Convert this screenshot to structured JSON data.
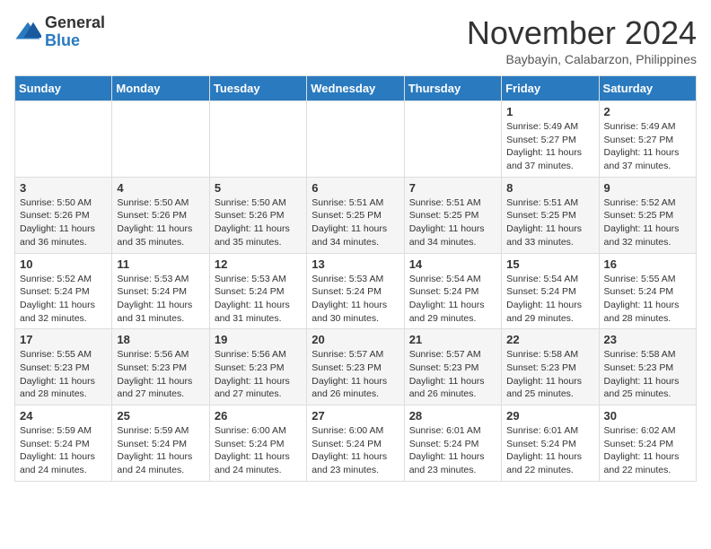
{
  "logo": {
    "general": "General",
    "blue": "Blue"
  },
  "title": "November 2024",
  "location": "Baybayin, Calabarzon, Philippines",
  "weekdays": [
    "Sunday",
    "Monday",
    "Tuesday",
    "Wednesday",
    "Thursday",
    "Friday",
    "Saturday"
  ],
  "weeks": [
    [
      {
        "day": "",
        "info": ""
      },
      {
        "day": "",
        "info": ""
      },
      {
        "day": "",
        "info": ""
      },
      {
        "day": "",
        "info": ""
      },
      {
        "day": "",
        "info": ""
      },
      {
        "day": "1",
        "info": "Sunrise: 5:49 AM\nSunset: 5:27 PM\nDaylight: 11 hours and 37 minutes."
      },
      {
        "day": "2",
        "info": "Sunrise: 5:49 AM\nSunset: 5:27 PM\nDaylight: 11 hours and 37 minutes."
      }
    ],
    [
      {
        "day": "3",
        "info": "Sunrise: 5:50 AM\nSunset: 5:26 PM\nDaylight: 11 hours and 36 minutes."
      },
      {
        "day": "4",
        "info": "Sunrise: 5:50 AM\nSunset: 5:26 PM\nDaylight: 11 hours and 35 minutes."
      },
      {
        "day": "5",
        "info": "Sunrise: 5:50 AM\nSunset: 5:26 PM\nDaylight: 11 hours and 35 minutes."
      },
      {
        "day": "6",
        "info": "Sunrise: 5:51 AM\nSunset: 5:25 PM\nDaylight: 11 hours and 34 minutes."
      },
      {
        "day": "7",
        "info": "Sunrise: 5:51 AM\nSunset: 5:25 PM\nDaylight: 11 hours and 34 minutes."
      },
      {
        "day": "8",
        "info": "Sunrise: 5:51 AM\nSunset: 5:25 PM\nDaylight: 11 hours and 33 minutes."
      },
      {
        "day": "9",
        "info": "Sunrise: 5:52 AM\nSunset: 5:25 PM\nDaylight: 11 hours and 32 minutes."
      }
    ],
    [
      {
        "day": "10",
        "info": "Sunrise: 5:52 AM\nSunset: 5:24 PM\nDaylight: 11 hours and 32 minutes."
      },
      {
        "day": "11",
        "info": "Sunrise: 5:53 AM\nSunset: 5:24 PM\nDaylight: 11 hours and 31 minutes."
      },
      {
        "day": "12",
        "info": "Sunrise: 5:53 AM\nSunset: 5:24 PM\nDaylight: 11 hours and 31 minutes."
      },
      {
        "day": "13",
        "info": "Sunrise: 5:53 AM\nSunset: 5:24 PM\nDaylight: 11 hours and 30 minutes."
      },
      {
        "day": "14",
        "info": "Sunrise: 5:54 AM\nSunset: 5:24 PM\nDaylight: 11 hours and 29 minutes."
      },
      {
        "day": "15",
        "info": "Sunrise: 5:54 AM\nSunset: 5:24 PM\nDaylight: 11 hours and 29 minutes."
      },
      {
        "day": "16",
        "info": "Sunrise: 5:55 AM\nSunset: 5:24 PM\nDaylight: 11 hours and 28 minutes."
      }
    ],
    [
      {
        "day": "17",
        "info": "Sunrise: 5:55 AM\nSunset: 5:23 PM\nDaylight: 11 hours and 28 minutes."
      },
      {
        "day": "18",
        "info": "Sunrise: 5:56 AM\nSunset: 5:23 PM\nDaylight: 11 hours and 27 minutes."
      },
      {
        "day": "19",
        "info": "Sunrise: 5:56 AM\nSunset: 5:23 PM\nDaylight: 11 hours and 27 minutes."
      },
      {
        "day": "20",
        "info": "Sunrise: 5:57 AM\nSunset: 5:23 PM\nDaylight: 11 hours and 26 minutes."
      },
      {
        "day": "21",
        "info": "Sunrise: 5:57 AM\nSunset: 5:23 PM\nDaylight: 11 hours and 26 minutes."
      },
      {
        "day": "22",
        "info": "Sunrise: 5:58 AM\nSunset: 5:23 PM\nDaylight: 11 hours and 25 minutes."
      },
      {
        "day": "23",
        "info": "Sunrise: 5:58 AM\nSunset: 5:23 PM\nDaylight: 11 hours and 25 minutes."
      }
    ],
    [
      {
        "day": "24",
        "info": "Sunrise: 5:59 AM\nSunset: 5:24 PM\nDaylight: 11 hours and 24 minutes."
      },
      {
        "day": "25",
        "info": "Sunrise: 5:59 AM\nSunset: 5:24 PM\nDaylight: 11 hours and 24 minutes."
      },
      {
        "day": "26",
        "info": "Sunrise: 6:00 AM\nSunset: 5:24 PM\nDaylight: 11 hours and 24 minutes."
      },
      {
        "day": "27",
        "info": "Sunrise: 6:00 AM\nSunset: 5:24 PM\nDaylight: 11 hours and 23 minutes."
      },
      {
        "day": "28",
        "info": "Sunrise: 6:01 AM\nSunset: 5:24 PM\nDaylight: 11 hours and 23 minutes."
      },
      {
        "day": "29",
        "info": "Sunrise: 6:01 AM\nSunset: 5:24 PM\nDaylight: 11 hours and 22 minutes."
      },
      {
        "day": "30",
        "info": "Sunrise: 6:02 AM\nSunset: 5:24 PM\nDaylight: 11 hours and 22 minutes."
      }
    ]
  ]
}
